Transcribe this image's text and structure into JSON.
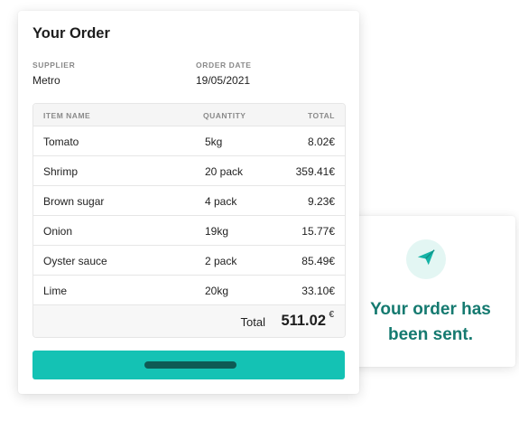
{
  "order": {
    "title": "Your Order",
    "supplier": {
      "label": "SUPPLIER",
      "value": "Metro"
    },
    "order_date": {
      "label": "ORDER DATE",
      "value": "19/05/2021"
    },
    "table": {
      "columns": [
        "ITEM NAME",
        "QUANTITY",
        "TOTAL"
      ],
      "rows": [
        {
          "name": "Tomato",
          "quantity": "5kg",
          "total": "8.02€"
        },
        {
          "name": "Shrimp",
          "quantity": "20 pack",
          "total": "359.41€"
        },
        {
          "name": "Brown sugar",
          "quantity": "4 pack",
          "total": "9.23€"
        },
        {
          "name": "Onion",
          "quantity": "19kg",
          "total": "15.77€"
        },
        {
          "name": "Oyster sauce",
          "quantity": "2 pack",
          "total": "85.49€"
        },
        {
          "name": "Lime",
          "quantity": "20kg",
          "total": "33.10€"
        }
      ],
      "total_label": "Total",
      "total_value": "511.02",
      "total_currency": "€"
    },
    "submit_button": {
      "label_placeholder": "redacted-label-bar"
    }
  },
  "confirmation": {
    "icon": "paper-plane-icon",
    "message": "Your order has been sent."
  },
  "colors": {
    "accent": "#14c2b4",
    "confirmation_text": "#157a70",
    "icon_bg": "#e3f6f3"
  }
}
